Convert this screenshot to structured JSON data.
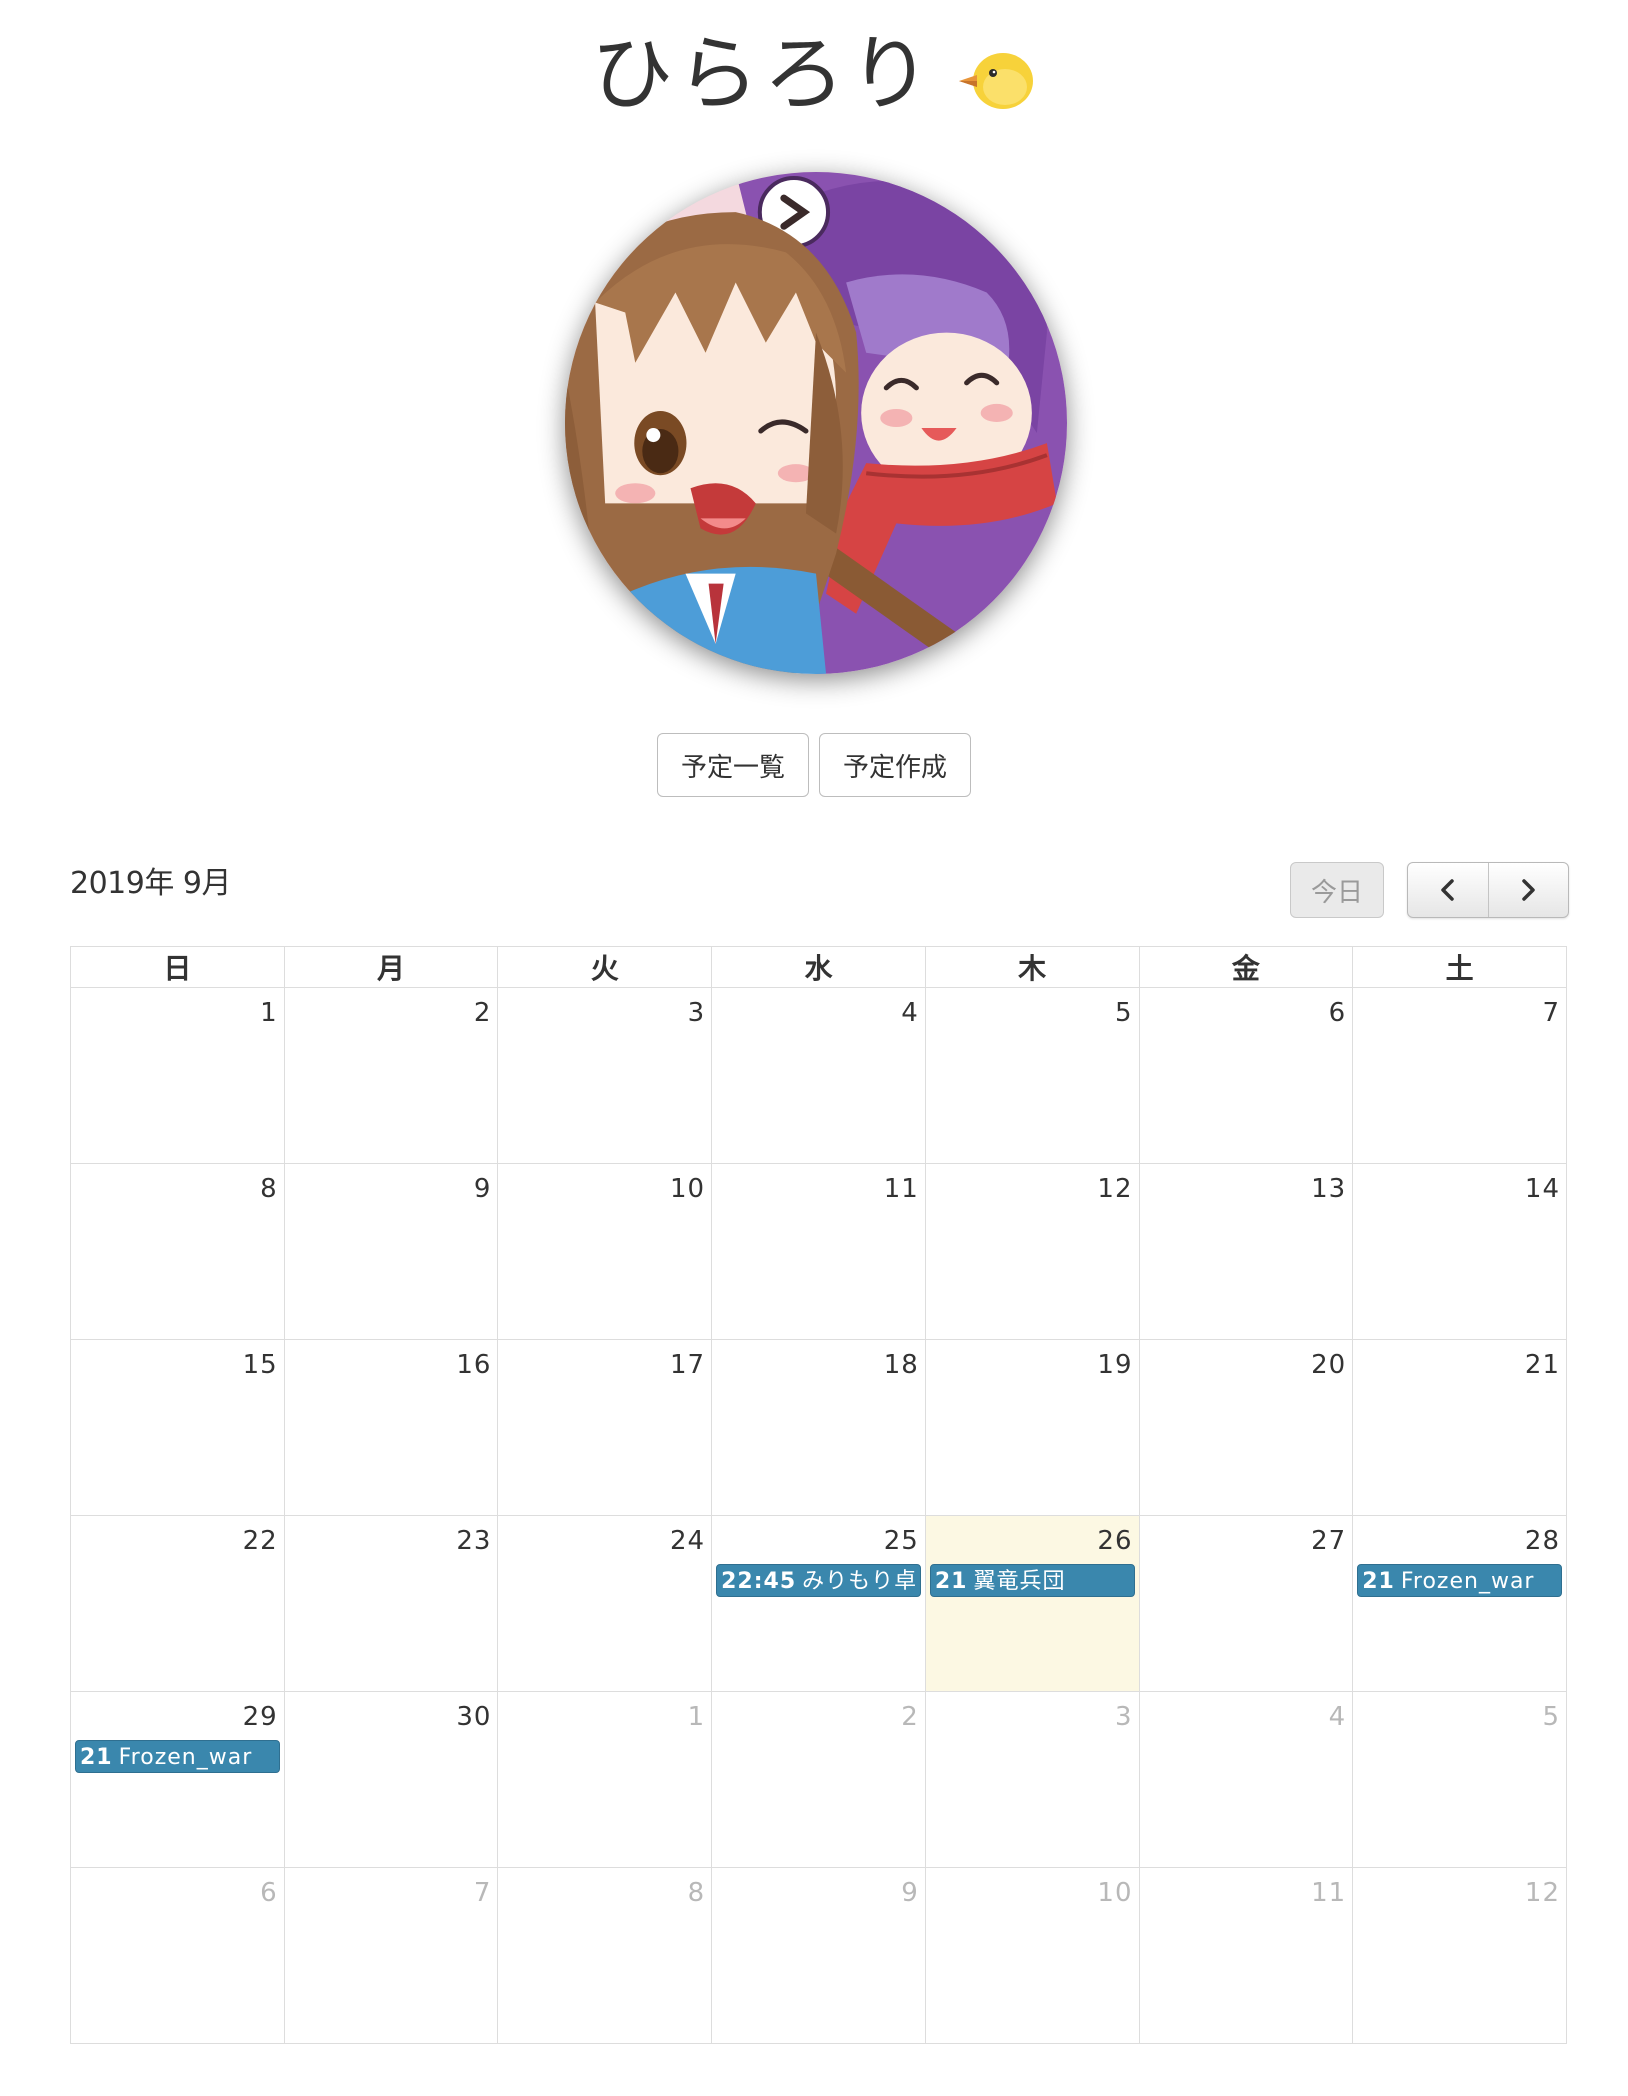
{
  "header": {
    "title": "ひらろり",
    "title_emoji": "chick-icon"
  },
  "actions": {
    "list_label": "予定一覧",
    "create_label": "予定作成"
  },
  "calendar": {
    "month_label": "2019年 9月",
    "today_label": "今日",
    "prev_icon": "chevron-left-icon",
    "next_icon": "chevron-right-icon",
    "weekdays": [
      "日",
      "月",
      "火",
      "水",
      "木",
      "金",
      "土"
    ],
    "weeks": [
      [
        {
          "d": "1"
        },
        {
          "d": "2"
        },
        {
          "d": "3"
        },
        {
          "d": "4"
        },
        {
          "d": "5"
        },
        {
          "d": "6"
        },
        {
          "d": "7"
        }
      ],
      [
        {
          "d": "8"
        },
        {
          "d": "9"
        },
        {
          "d": "10"
        },
        {
          "d": "11"
        },
        {
          "d": "12"
        },
        {
          "d": "13"
        },
        {
          "d": "14"
        }
      ],
      [
        {
          "d": "15"
        },
        {
          "d": "16"
        },
        {
          "d": "17"
        },
        {
          "d": "18"
        },
        {
          "d": "19"
        },
        {
          "d": "20"
        },
        {
          "d": "21"
        }
      ],
      [
        {
          "d": "22"
        },
        {
          "d": "23"
        },
        {
          "d": "24"
        },
        {
          "d": "25",
          "event": {
            "time": "22:45",
            "title": "みりもり卓"
          }
        },
        {
          "d": "26",
          "today": true,
          "event": {
            "time": "21",
            "title": "翼竜兵団"
          }
        },
        {
          "d": "27"
        },
        {
          "d": "28",
          "event": {
            "time": "21",
            "title": "Frozen_war"
          }
        }
      ],
      [
        {
          "d": "29",
          "event": {
            "time": "21",
            "title": "Frozen_war"
          }
        },
        {
          "d": "30"
        },
        {
          "d": "1",
          "other": true
        },
        {
          "d": "2",
          "other": true
        },
        {
          "d": "3",
          "other": true
        },
        {
          "d": "4",
          "other": true
        },
        {
          "d": "5",
          "other": true
        }
      ],
      [
        {
          "d": "6",
          "other": true
        },
        {
          "d": "7",
          "other": true
        },
        {
          "d": "8",
          "other": true
        },
        {
          "d": "9",
          "other": true
        },
        {
          "d": "10",
          "other": true
        },
        {
          "d": "11",
          "other": true
        },
        {
          "d": "12",
          "other": true
        }
      ]
    ]
  },
  "colors": {
    "event_bg": "#3a87ad",
    "today_bg": "#fcf8e3",
    "grid_border": "#dddddd"
  }
}
